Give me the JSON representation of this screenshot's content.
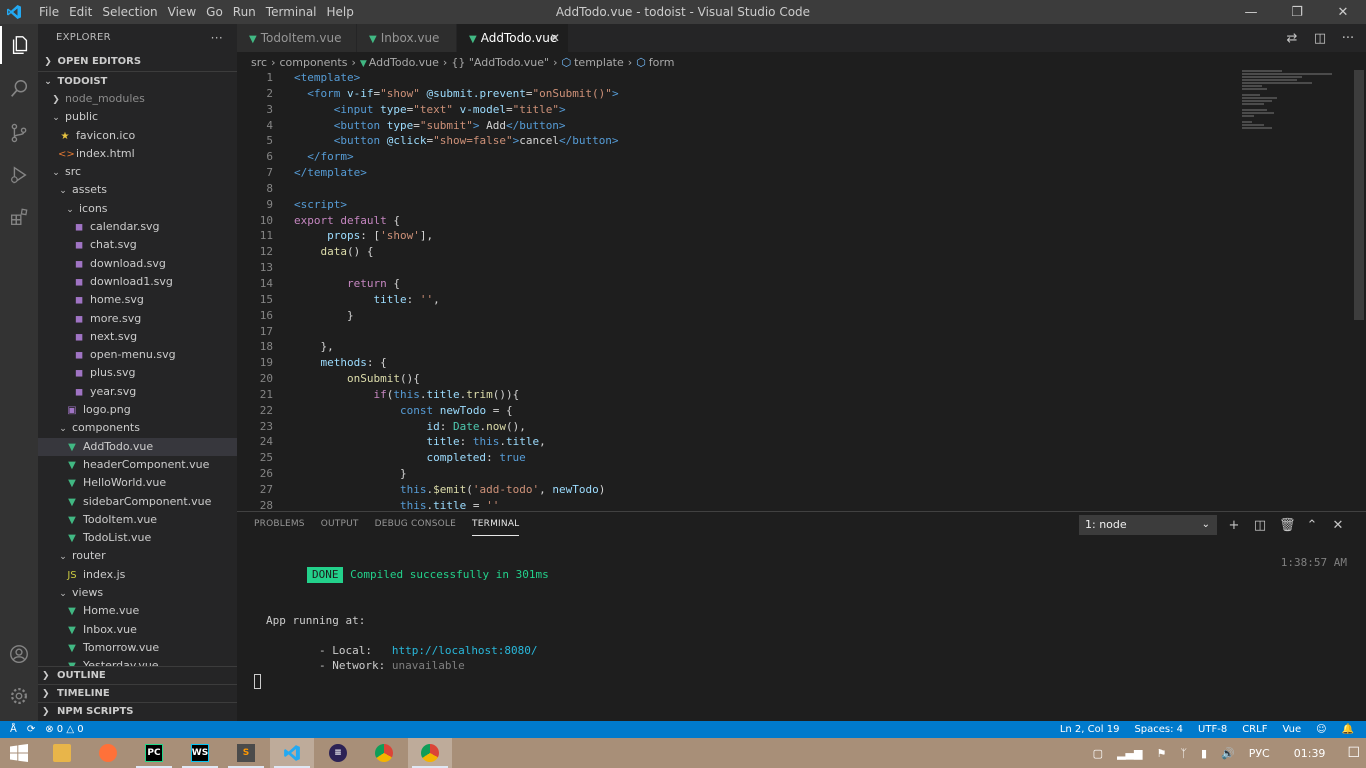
{
  "window": {
    "title": "AddTodo.vue - todoist - Visual Studio Code",
    "menu": [
      "File",
      "Edit",
      "Selection",
      "View",
      "Go",
      "Run",
      "Terminal",
      "Help"
    ]
  },
  "sidebar": {
    "title": "EXPLORER",
    "more": "···",
    "open_editors": "OPEN EDITORS",
    "root": "TODOIST",
    "tree": [
      {
        "label": "node_modules",
        "depth": 1,
        "kind": "folder",
        "expanded": false,
        "dim": true
      },
      {
        "label": "public",
        "depth": 1,
        "kind": "folder",
        "expanded": true
      },
      {
        "label": "favicon.ico",
        "depth": 2,
        "kind": "star"
      },
      {
        "label": "index.html",
        "depth": 2,
        "kind": "html"
      },
      {
        "label": "src",
        "depth": 1,
        "kind": "folder",
        "expanded": true
      },
      {
        "label": "assets",
        "depth": 2,
        "kind": "folder",
        "expanded": true
      },
      {
        "label": "icons",
        "depth": 3,
        "kind": "folder",
        "expanded": true
      },
      {
        "label": "calendar.svg",
        "depth": 4,
        "kind": "svg"
      },
      {
        "label": "chat.svg",
        "depth": 4,
        "kind": "svg"
      },
      {
        "label": "download.svg",
        "depth": 4,
        "kind": "svg"
      },
      {
        "label": "download1.svg",
        "depth": 4,
        "kind": "svg"
      },
      {
        "label": "home.svg",
        "depth": 4,
        "kind": "svg"
      },
      {
        "label": "more.svg",
        "depth": 4,
        "kind": "svg"
      },
      {
        "label": "next.svg",
        "depth": 4,
        "kind": "svg"
      },
      {
        "label": "open-menu.svg",
        "depth": 4,
        "kind": "svg"
      },
      {
        "label": "plus.svg",
        "depth": 4,
        "kind": "svg"
      },
      {
        "label": "year.svg",
        "depth": 4,
        "kind": "svg"
      },
      {
        "label": "logo.png",
        "depth": 3,
        "kind": "png"
      },
      {
        "label": "components",
        "depth": 2,
        "kind": "folder",
        "expanded": true
      },
      {
        "label": "AddTodo.vue",
        "depth": 3,
        "kind": "vue",
        "selected": true
      },
      {
        "label": "headerComponent.vue",
        "depth": 3,
        "kind": "vue"
      },
      {
        "label": "HelloWorld.vue",
        "depth": 3,
        "kind": "vue"
      },
      {
        "label": "sidebarComponent.vue",
        "depth": 3,
        "kind": "vue"
      },
      {
        "label": "TodoItem.vue",
        "depth": 3,
        "kind": "vue"
      },
      {
        "label": "TodoList.vue",
        "depth": 3,
        "kind": "vue"
      },
      {
        "label": "router",
        "depth": 2,
        "kind": "folder",
        "expanded": true
      },
      {
        "label": "index.js",
        "depth": 3,
        "kind": "js"
      },
      {
        "label": "views",
        "depth": 2,
        "kind": "folder",
        "expanded": true
      },
      {
        "label": "Home.vue",
        "depth": 3,
        "kind": "vue"
      },
      {
        "label": "Inbox.vue",
        "depth": 3,
        "kind": "vue"
      },
      {
        "label": "Tomorrow.vue",
        "depth": 3,
        "kind": "vue"
      },
      {
        "label": "Yesterday.vue",
        "depth": 3,
        "kind": "vue"
      }
    ],
    "outline": "OUTLINE",
    "timeline": "TIMELINE",
    "npm_scripts": "NPM SCRIPTS"
  },
  "tabs": [
    {
      "label": "TodoItem.vue",
      "active": false
    },
    {
      "label": "Inbox.vue",
      "active": false
    },
    {
      "label": "AddTodo.vue",
      "active": true
    }
  ],
  "breadcrumbs": {
    "src": "src",
    "components": "components",
    "file": "AddTodo.vue",
    "braces": "{}",
    "script": "\"AddTodo.vue\"",
    "template": "template",
    "form": "form"
  },
  "code_lines": [
    [
      [
        "t-tag",
        "<template>"
      ]
    ],
    [
      [
        "t-tag",
        "  <form "
      ],
      [
        "t-attr",
        "v-if"
      ],
      [
        "t-txt",
        "="
      ],
      [
        "t-str",
        "\"show\""
      ],
      [
        "t-txt",
        " "
      ],
      [
        "t-attr",
        "@submit.prevent"
      ],
      [
        "t-txt",
        "="
      ],
      [
        "t-str",
        "\"onSubmit()\""
      ],
      [
        "t-tag",
        ">"
      ]
    ],
    [
      [
        "t-tag",
        "      <input "
      ],
      [
        "t-attr",
        "type"
      ],
      [
        "t-txt",
        "="
      ],
      [
        "t-str",
        "\"text\""
      ],
      [
        "t-txt",
        " "
      ],
      [
        "t-attr",
        "v-model"
      ],
      [
        "t-txt",
        "="
      ],
      [
        "t-str",
        "\"title\""
      ],
      [
        "t-tag",
        ">"
      ]
    ],
    [
      [
        "t-tag",
        "      <button "
      ],
      [
        "t-attr",
        "type"
      ],
      [
        "t-txt",
        "="
      ],
      [
        "t-str",
        "\"submit\""
      ],
      [
        "t-tag",
        ">"
      ],
      [
        "t-txt",
        " Add"
      ],
      [
        "t-tag",
        "</button>"
      ]
    ],
    [
      [
        "t-tag",
        "      <button "
      ],
      [
        "t-attr",
        "@click"
      ],
      [
        "t-txt",
        "="
      ],
      [
        "t-str",
        "\"show=false\""
      ],
      [
        "t-tag",
        ">"
      ],
      [
        "t-txt",
        "cancel"
      ],
      [
        "t-tag",
        "</button>"
      ]
    ],
    [
      [
        "t-tag",
        "  </form>"
      ]
    ],
    [
      [
        "t-tag",
        "</template>"
      ]
    ],
    [
      [
        "t-txt",
        ""
      ]
    ],
    [
      [
        "t-tag",
        "<script>"
      ]
    ],
    [
      [
        "t-kw",
        "export"
      ],
      [
        "t-txt",
        " "
      ],
      [
        "t-kw",
        "default"
      ],
      [
        "t-txt",
        " {"
      ]
    ],
    [
      [
        "t-txt",
        "     "
      ],
      [
        "t-attr",
        "props"
      ],
      [
        "t-txt",
        ": ["
      ],
      [
        "t-str",
        "'show'"
      ],
      [
        "t-txt",
        "],"
      ]
    ],
    [
      [
        "t-txt",
        "    "
      ],
      [
        "t-fn",
        "data"
      ],
      [
        "t-txt",
        "() {"
      ]
    ],
    [
      [
        "t-txt",
        ""
      ]
    ],
    [
      [
        "t-txt",
        "        "
      ],
      [
        "t-kw",
        "return"
      ],
      [
        "t-txt",
        " {"
      ]
    ],
    [
      [
        "t-txt",
        "            "
      ],
      [
        "t-attr",
        "title"
      ],
      [
        "t-txt",
        ": "
      ],
      [
        "t-str",
        "''"
      ],
      [
        "t-txt",
        ","
      ]
    ],
    [
      [
        "t-txt",
        "        }"
      ]
    ],
    [
      [
        "t-txt",
        ""
      ]
    ],
    [
      [
        "t-txt",
        "    },"
      ]
    ],
    [
      [
        "t-txt",
        "    "
      ],
      [
        "t-attr",
        "methods"
      ],
      [
        "t-txt",
        ": {"
      ]
    ],
    [
      [
        "t-txt",
        "        "
      ],
      [
        "t-fn",
        "onSubmit"
      ],
      [
        "t-txt",
        "(){"
      ]
    ],
    [
      [
        "t-txt",
        "            "
      ],
      [
        "t-kw",
        "if"
      ],
      [
        "t-txt",
        "("
      ],
      [
        "t-kw2",
        "this"
      ],
      [
        "t-txt",
        "."
      ],
      [
        "t-attr",
        "title"
      ],
      [
        "t-txt",
        "."
      ],
      [
        "t-fn",
        "trim"
      ],
      [
        "t-txt",
        "()){"
      ]
    ],
    [
      [
        "t-txt",
        "                "
      ],
      [
        "t-kw2",
        "const"
      ],
      [
        "t-txt",
        " "
      ],
      [
        "t-attr",
        "newTodo"
      ],
      [
        "t-txt",
        " = {"
      ]
    ],
    [
      [
        "t-txt",
        "                    "
      ],
      [
        "t-attr",
        "id"
      ],
      [
        "t-txt",
        ": "
      ],
      [
        "t-cls",
        "Date"
      ],
      [
        "t-txt",
        "."
      ],
      [
        "t-fn",
        "now"
      ],
      [
        "t-txt",
        "(),"
      ]
    ],
    [
      [
        "t-txt",
        "                    "
      ],
      [
        "t-attr",
        "title"
      ],
      [
        "t-txt",
        ": "
      ],
      [
        "t-kw2",
        "this"
      ],
      [
        "t-txt",
        "."
      ],
      [
        "t-attr",
        "title"
      ],
      [
        "t-txt",
        ","
      ]
    ],
    [
      [
        "t-txt",
        "                    "
      ],
      [
        "t-attr",
        "completed"
      ],
      [
        "t-txt",
        ": "
      ],
      [
        "t-kw2",
        "true"
      ]
    ],
    [
      [
        "t-txt",
        "                }"
      ]
    ],
    [
      [
        "t-txt",
        "                "
      ],
      [
        "t-kw2",
        "this"
      ],
      [
        "t-txt",
        "."
      ],
      [
        "t-fn",
        "$emit"
      ],
      [
        "t-txt",
        "("
      ],
      [
        "t-str",
        "'add-todo'"
      ],
      [
        "t-txt",
        ", "
      ],
      [
        "t-attr",
        "newTodo"
      ],
      [
        "t-txt",
        ")"
      ]
    ],
    [
      [
        "t-txt",
        "                "
      ],
      [
        "t-kw2",
        "this"
      ],
      [
        "t-txt",
        "."
      ],
      [
        "t-attr",
        "title"
      ],
      [
        "t-txt",
        " = "
      ],
      [
        "t-str",
        "''"
      ]
    ]
  ],
  "panel": {
    "tabs": [
      "PROBLEMS",
      "OUTPUT",
      "DEBUG CONSOLE",
      "TERMINAL"
    ],
    "active_tab": "TERMINAL",
    "terminal_select": "1: node",
    "done_badge": "DONE",
    "compiled": "Compiled successfully in 301ms",
    "time": "1:38:57 AM",
    "app_running": "App running at:",
    "local_label": "- Local:   ",
    "local_url": "http://localhost:8080/",
    "network_label": "- Network: ",
    "network_value": "unavailable"
  },
  "statusbar": {
    "errors": "0",
    "warnings": "0",
    "position": "Ln 2, Col 19",
    "spaces": "Spaces: 4",
    "encoding": "UTF-8",
    "eol": "CRLF",
    "language": "Vue"
  },
  "taskbar": {
    "lang": "РУС",
    "clock": "01:39"
  },
  "colors": {
    "accent": "#007acc",
    "vue_green": "#41b883",
    "done_green": "#23d18b"
  }
}
